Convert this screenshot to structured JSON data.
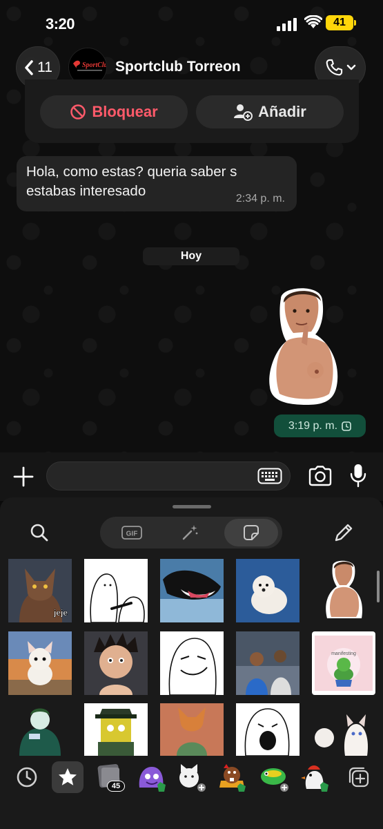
{
  "status_bar": {
    "time": "3:20",
    "battery": "41"
  },
  "header": {
    "back_count": "11",
    "contact_name": "Sportclub Torreon",
    "avatar_text": "SportClub"
  },
  "actions": {
    "block_label": "Bloquear",
    "add_label": "Añadir"
  },
  "messages": {
    "incoming": {
      "text": "Hola, como estas? queria saber s estabas interesado",
      "time": "2:34 p. m."
    },
    "date_divider": "Hoy",
    "outgoing_sticker": {
      "time": "3:19 p. m."
    }
  },
  "composer": {
    "value": ""
  },
  "sticker_panel": {
    "tabs": [
      "gif",
      "magic",
      "stickers"
    ],
    "active_tab": "stickers",
    "grid_labels": {
      "werewolf": "jeje",
      "frog_card": "manifesting"
    },
    "tray_badge": "45"
  },
  "colors": {
    "outgoing_bubble": "#124f3b",
    "block_red": "#ff5a6a",
    "battery": "#ffd60a"
  }
}
